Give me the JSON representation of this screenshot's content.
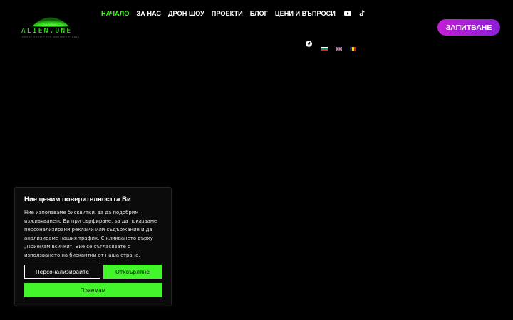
{
  "colors": {
    "background": "#000000",
    "accent_green": "#39ff14",
    "button_green": "#43f52b",
    "cta_gradient_start": "#c31fd6",
    "cta_gradient_end": "#8a1fd6",
    "text": "#ffffff"
  },
  "logo": {
    "text": "ALIEN.ONE",
    "tagline": "DRONE SHOW FROM ANOTHER PLANET",
    "icon": "ufo-icon"
  },
  "nav": {
    "items": [
      {
        "label": "НАЧАЛО",
        "active": true
      },
      {
        "label": "ЗА НАС",
        "active": false
      },
      {
        "label": "ДРОН ШОУ",
        "active": false
      },
      {
        "label": "ПРОЕКТИ",
        "active": false
      },
      {
        "label": "БЛОГ",
        "active": false
      },
      {
        "label": "ЦЕНИ И ВЪПРОСИ",
        "active": false
      }
    ],
    "icons": [
      "youtube-icon",
      "tiktok-icon"
    ]
  },
  "social": {
    "icons": [
      "facebook-icon"
    ],
    "languages": [
      "Български",
      "English",
      "Română"
    ]
  },
  "cta": {
    "label": "ЗАПИТВАНЕ"
  },
  "cookie_banner": {
    "title": "Ние ценим поверителността Ви",
    "text": "Ние използваме бисквитки, за да подобрим\nизживяването Ви при сърфиране, за да показваме\nперсонализирани реклами или съдържание и да\nанализираме нашия трафик. С кликването върху\n„Приемам всички“, Вие се съгласявате с\nизползването на бисквитки от наша страна.",
    "customize_label": "Персонализирайте",
    "reject_label": "Отхвърляне",
    "accept_label": "Приемам"
  }
}
